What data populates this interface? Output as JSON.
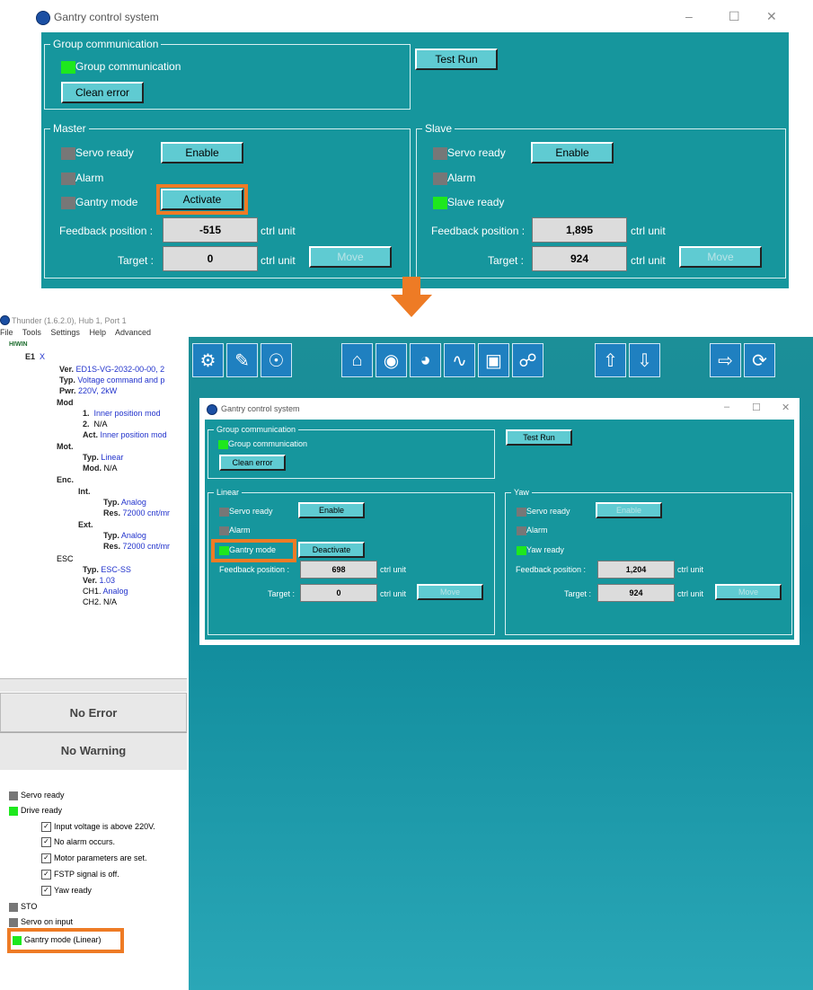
{
  "top_window": {
    "title": "Gantry control system",
    "group": {
      "legend": "Group communication",
      "indicator": "Group communication",
      "clean_error": "Clean error",
      "test_run": "Test Run"
    },
    "master": {
      "legend": "Master",
      "servo_ready": "Servo ready",
      "enable": "Enable",
      "alarm": "Alarm",
      "gantry_mode": "Gantry mode",
      "activate": "Activate",
      "feedback_label": "Feedback position :",
      "feedback_value": "-515",
      "unit": "ctrl unit",
      "target_label": "Target :",
      "target_value": "0",
      "move": "Move"
    },
    "slave": {
      "legend": "Slave",
      "servo_ready": "Servo ready",
      "enable": "Enable",
      "alarm": "Alarm",
      "slave_ready": "Slave ready",
      "feedback_label": "Feedback position :",
      "feedback_value": "1,895",
      "unit": "ctrl unit",
      "target_label": "Target :",
      "target_value": "924",
      "move": "Move"
    }
  },
  "app": {
    "title": "Thunder (1.6.2.0), Hub 1, Port 1",
    "menu": [
      "File",
      "Tools",
      "Settings",
      "Help",
      "Advanced"
    ],
    "tree": {
      "root": "HIWIN",
      "e1": "E1",
      "e1_axis": "X",
      "ver_k": "Ver.",
      "ver_v": "ED1S-VG-2032-00-00, 2",
      "typ_k": "Typ.",
      "typ_v": "Voltage command and p",
      "pwr_k": "Pwr.",
      "pwr_v": "220V, 2kW",
      "mod": "Mod",
      "mod1_k": "1.",
      "mod1_v": "Inner position mod",
      "mod2_k": "2.",
      "mod2_v": "N/A",
      "act_k": "Act.",
      "act_v": "Inner position mod",
      "mot": "Mot.",
      "mot_typ_k": "Typ.",
      "mot_typ_v": "Linear",
      "mot_mod_k": "Mod.",
      "mot_mod_v": "N/A",
      "enc": "Enc.",
      "int": "Int.",
      "int_typ_k": "Typ.",
      "int_typ_v": "Analog",
      "int_res_k": "Res.",
      "int_res_v": "72000 cnt/mr",
      "ext": "Ext.",
      "ext_typ_k": "Typ.",
      "ext_typ_v": "Analog",
      "ext_res_k": "Res.",
      "ext_res_v": "72000 cnt/mr",
      "esc": "ESC",
      "esc_typ_k": "Typ.",
      "esc_typ_v": "ESC-SS",
      "esc_ver_k": "Ver.",
      "esc_ver_v": "1.03",
      "ch1_k": "CH1.",
      "ch1_v": "Analog",
      "ch2_k": "CH2.",
      "ch2_v": "N/A"
    },
    "no_error": "No Error",
    "no_warning": "No Warning",
    "status": {
      "servo_ready": "Servo ready",
      "drive_ready": "Drive ready",
      "c1": "Input voltage is above 220V.",
      "c2": "No alarm occurs.",
      "c3": "Motor parameters are set.",
      "c4": "FSTP signal is off.",
      "c5": "Yaw ready",
      "sto": "STO",
      "servo_on": "Servo on input",
      "gantry_mode": "Gantry mode  (Linear)"
    },
    "toolbar_icons": [
      "gear-wrench-icon",
      "document-edit-icon",
      "steering-wheel-icon",
      "home-icon",
      "eye-icon",
      "gauge-icon",
      "waveform-icon",
      "connector-icon",
      "network-icon",
      "upload-icon",
      "download-icon",
      "import-icon",
      "power-cycle-icon"
    ]
  },
  "inner_window": {
    "title": "Gantry control system",
    "group": {
      "legend": "Group communication",
      "indicator": "Group communication",
      "clean_error": "Clean error",
      "test_run": "Test Run"
    },
    "linear": {
      "legend": "Linear",
      "servo_ready": "Servo ready",
      "enable": "Enable",
      "alarm": "Alarm",
      "gantry_mode": "Gantry mode",
      "deactivate": "Deactivate",
      "feedback_label": "Feedback position :",
      "feedback_value": "698",
      "unit": "ctrl unit",
      "target_label": "Target :",
      "target_value": "0",
      "move": "Move"
    },
    "yaw": {
      "legend": "Yaw",
      "servo_ready": "Servo ready",
      "enable": "Enable",
      "alarm": "Alarm",
      "yaw_ready": "Yaw ready",
      "feedback_label": "Feedback position :",
      "feedback_value": "1,204",
      "unit": "ctrl unit",
      "target_label": "Target :",
      "target_value": "924",
      "move": "Move"
    }
  },
  "colors": {
    "panel_teal": "#16969d",
    "highlight_orange": "#ee7b25",
    "led_green": "#1ee81e",
    "led_gray": "#777777",
    "button_cyan": "#5fcbd2"
  }
}
